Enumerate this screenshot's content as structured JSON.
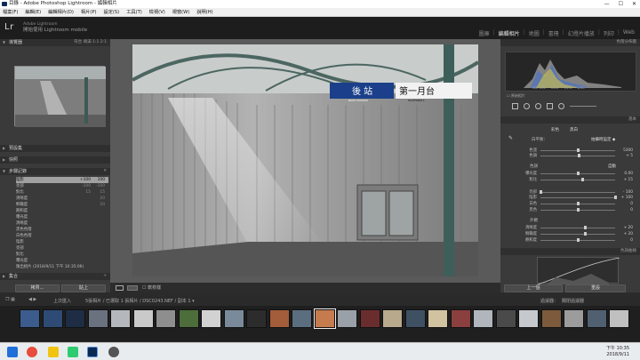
{
  "window": {
    "title": "目錄 - Adobe Photoshop Lightroom - 編輯相片",
    "controls": [
      "—",
      "☐",
      "✕"
    ]
  },
  "menu": [
    "檔案(F)",
    "編輯(E)",
    "編輯相片(D)",
    "相片(P)",
    "設定(S)",
    "工具(T)",
    "檢視(V)",
    "視窗(W)",
    "說明(H)"
  ],
  "identity": {
    "logo": "Lr",
    "line1": "Adobe Lightroom",
    "line2": "開始使用 Lightroom mobile"
  },
  "modules": [
    {
      "label": "圖庫",
      "active": false
    },
    {
      "label": "編輯相片",
      "active": true
    },
    {
      "label": "地圖",
      "active": false
    },
    {
      "label": "書冊",
      "active": false
    },
    {
      "label": "幻燈片播放",
      "active": false
    },
    {
      "label": "列印",
      "active": false
    },
    {
      "label": "Web",
      "active": false
    }
  ],
  "left_panel": {
    "navigator": {
      "title": "導覽器",
      "zoom": [
        "符合",
        "填滿",
        "1:1",
        "2:1"
      ]
    },
    "presets": {
      "title": "預設集"
    },
    "snapshots": {
      "title": "快照"
    },
    "history": {
      "title": "步驟記錄",
      "rows": [
        {
          "label": "陰影",
          "v1": "+100",
          "v2": "100",
          "selected": true
        },
        {
          "label": "亮部",
          "v1": "-100",
          "v2": "-100"
        },
        {
          "label": "對比",
          "v1": "15",
          "v2": "15"
        },
        {
          "label": "清晰度",
          "v1": "",
          "v2": "20"
        },
        {
          "label": "鮮豔度",
          "v1": "",
          "v2": "20"
        },
        {
          "label": "飽和度",
          "v1": "",
          "v2": ""
        },
        {
          "label": "曝光度",
          "v1": "",
          "v2": ""
        },
        {
          "label": "清晰度",
          "v1": "",
          "v2": ""
        },
        {
          "label": "黑色色階",
          "v1": "",
          "v2": ""
        },
        {
          "label": "白色色階",
          "v1": "",
          "v2": ""
        },
        {
          "label": "陰影",
          "v1": "",
          "v2": ""
        },
        {
          "label": "亮部",
          "v1": "",
          "v2": ""
        },
        {
          "label": "對比",
          "v1": "",
          "v2": ""
        },
        {
          "label": "曝光度",
          "v1": "",
          "v2": ""
        },
        {
          "label": "匯出相片 (2018/9/11 下午 10:35:06)",
          "v1": "",
          "v2": ""
        }
      ]
    },
    "collections": {
      "title": "集合"
    },
    "copy_button": "拷貝…",
    "paste_button": "貼上"
  },
  "photo": {
    "sign_left": "後 站",
    "sign_left_sub": "BACK STATION",
    "sign_right": "第一月台",
    "sign_right_sub": "PLATFORM 1"
  },
  "toolbar": {
    "softproof": "軟校樣"
  },
  "right_panel": {
    "histogram": {
      "title": "色階分佈圖",
      "readout": [
        "ISO 200",
        "24.0",
        "f/1.4",
        "1/50"
      ],
      "original_label": "原始相片"
    },
    "basic": {
      "title": "基本",
      "treatment_color": "彩色",
      "treatment_bw": "黑白",
      "wb_label": "白平衡：",
      "wb_value": "拍攝時設定 ◆",
      "tone_label": "色調",
      "auto": "自動"
    },
    "sliders": [
      {
        "label": "色溫",
        "value": "5300",
        "pos": 0.5
      },
      {
        "label": "色調",
        "value": "+ 5",
        "pos": 0.52
      },
      {
        "label": "曝光度",
        "value": "0.00",
        "pos": 0.5
      },
      {
        "label": "對比",
        "value": "+ 15",
        "pos": 0.56
      },
      {
        "label": "亮部",
        "value": "- 100",
        "pos": 0.0
      },
      {
        "label": "陰影",
        "value": "+ 100",
        "pos": 1.0
      },
      {
        "label": "白色",
        "value": "0",
        "pos": 0.5
      },
      {
        "label": "黑色",
        "value": "0",
        "pos": 0.5
      },
      {
        "label": "清晰度",
        "value": "+ 20",
        "pos": 0.6
      },
      {
        "label": "鮮豔度",
        "value": "+ 20",
        "pos": 0.6
      },
      {
        "label": "飽和度",
        "value": "0",
        "pos": 0.5
      }
    ],
    "presence_label": "外觀",
    "tone_curve": {
      "title": "色調曲線"
    },
    "prev_button": "上一個",
    "reset_button": "重設"
  },
  "filmstrip": {
    "source": "上次匯入",
    "path": "5張相片 / 已選取 1 張相片 / DSC0243.NEF / 副本 1 ▾",
    "filter_label": "過濾器：",
    "filter_value": "關閉過濾器"
  },
  "taskbar": {
    "time": "下午 10:35",
    "date": "2018/9/11"
  }
}
